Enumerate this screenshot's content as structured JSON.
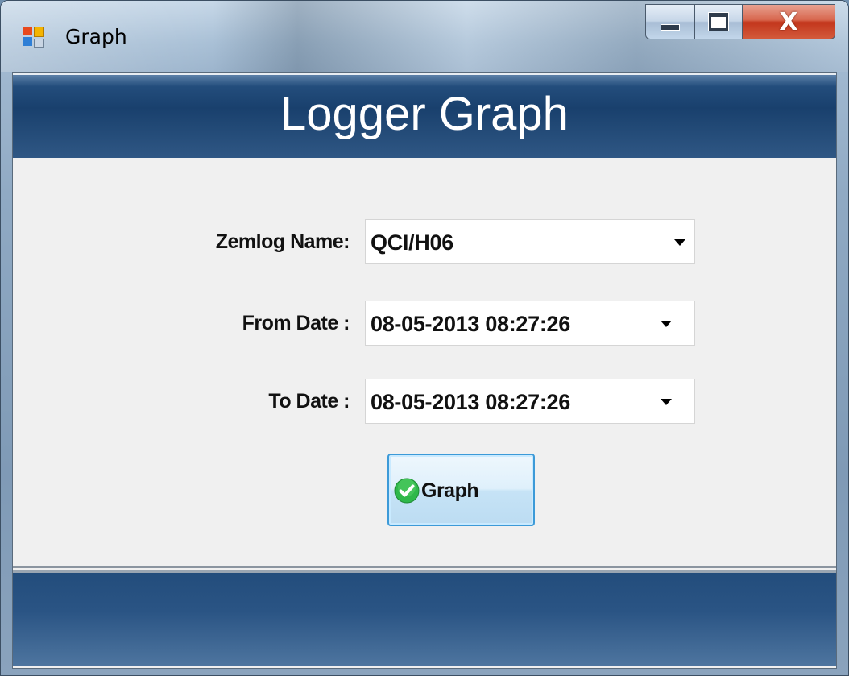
{
  "window": {
    "title": "Graph",
    "close_glyph": "X"
  },
  "header": {
    "title": "Logger Graph"
  },
  "form": {
    "zemlog_label": "Zemlog Name:",
    "zemlog_value": "QCI/H06",
    "from_label": "From Date :",
    "from_value": "08-05-2013 08:27:26",
    "to_label": "To Date :",
    "to_value": "08-05-2013 08:27:26"
  },
  "actions": {
    "graph_label": "Graph",
    "graph_icon": "check-circle-icon"
  },
  "colors": {
    "band": "#19406d",
    "accent_green": "#2fb84a",
    "button_border": "#3c9ad8"
  }
}
